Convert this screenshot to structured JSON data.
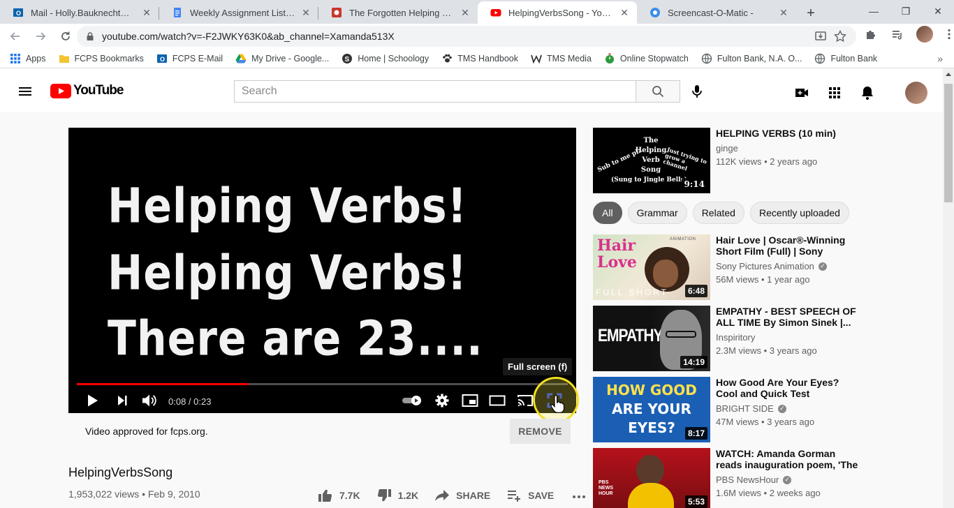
{
  "browser": {
    "tabs": [
      {
        "title": "Mail - Holly.Bauknecht@fcps.o",
        "icon": "outlook-icon",
        "active": false
      },
      {
        "title": "Weekly Assignment List: Week",
        "icon": "docs-icon",
        "active": false
      },
      {
        "title": "The Forgotten Helping Verbs :",
        "icon": "red-app-icon",
        "active": false
      },
      {
        "title": "HelpingVerbsSong - YouTube",
        "icon": "youtube-icon",
        "active": true
      },
      {
        "title": "Screencast-O-Matic -",
        "icon": "screencast-icon",
        "active": false
      }
    ],
    "url": "youtube.com/watch?v=-F2JWKY63K0&ab_channel=Xamanda513X",
    "bookmarks": [
      {
        "label": "Apps",
        "icon": "apps-grid-icon"
      },
      {
        "label": "FCPS Bookmarks",
        "icon": "folder-icon"
      },
      {
        "label": "FCPS E-Mail",
        "icon": "outlook-icon"
      },
      {
        "label": "My Drive - Google...",
        "icon": "drive-icon"
      },
      {
        "label": "Home | Schoology",
        "icon": "schoology-icon"
      },
      {
        "label": "TMS Handbook",
        "icon": "paw-icon"
      },
      {
        "label": "TMS Media",
        "icon": "w-icon"
      },
      {
        "label": "Online Stopwatch",
        "icon": "stopwatch-icon"
      },
      {
        "label": "Fulton Bank, N.A. O...",
        "icon": "globe-icon"
      },
      {
        "label": "Fulton Bank",
        "icon": "globe-icon"
      }
    ]
  },
  "youtube": {
    "logo_text": "YouTube",
    "search_placeholder": "Search"
  },
  "player": {
    "slide_lines": [
      "Helping Verbs!",
      "Helping Verbs!",
      "There are 23...."
    ],
    "time": "0:08 / 0:23",
    "progress_fraction": 0.35,
    "tooltip": "Full screen (f)"
  },
  "video": {
    "approved_text": "Video approved for fcps.org.",
    "remove_label": "REMOVE",
    "title": "HelpingVerbsSong",
    "views_date": "1,953,022 views • Feb 9, 2010",
    "likes": "7.7K",
    "dislikes": "1.2K",
    "share_label": "SHARE",
    "save_label": "SAVE"
  },
  "chips": [
    "All",
    "Grammar",
    "Related",
    "Recently uploaded"
  ],
  "related": [
    {
      "title": "HELPING VERBS (10 min)",
      "channel": "ginge",
      "verified": false,
      "stats": "112K views • 2 years ago",
      "duration": "9:14",
      "thumb_text": [
        "The",
        "Helping",
        "Verb",
        "Song",
        "(Sung to Jingle Bells)"
      ],
      "thumb_left": "Sub to me plz",
      "thumb_right": "Just trying to grow a channel"
    },
    {
      "title": "Hair Love | Oscar®-Winning Short Film (Full) | Sony Picture...",
      "channel": "Sony Pictures Animation",
      "verified": true,
      "stats": "56M views • 1 year ago",
      "duration": "6:48",
      "thumb_text": [
        "Hair",
        "Love",
        "FULL SHORT",
        "ANIMATION"
      ]
    },
    {
      "title": "EMPATHY - BEST SPEECH OF ALL TIME By Simon Sinek |...",
      "channel": "Inspiritory",
      "verified": false,
      "stats": "2.3M views • 3 years ago",
      "duration": "14:19",
      "thumb_text": [
        "EMPATHY"
      ]
    },
    {
      "title": "How Good Are Your Eyes? Cool and Quick Test",
      "channel": "BRIGHT SIDE",
      "verified": true,
      "stats": "47M views • 3 years ago",
      "duration": "8:17",
      "thumb_text": [
        "HOW GOOD",
        "ARE YOUR",
        "EYES?"
      ]
    },
    {
      "title": "WATCH: Amanda Gorman reads inauguration poem, 'The Hill W...",
      "channel": "PBS NewsHour",
      "verified": true,
      "stats": "1.6M views • 2 weeks ago",
      "duration": "5:53",
      "thumb_text": [
        "PBS",
        "NEWS",
        "HOUR"
      ]
    }
  ]
}
